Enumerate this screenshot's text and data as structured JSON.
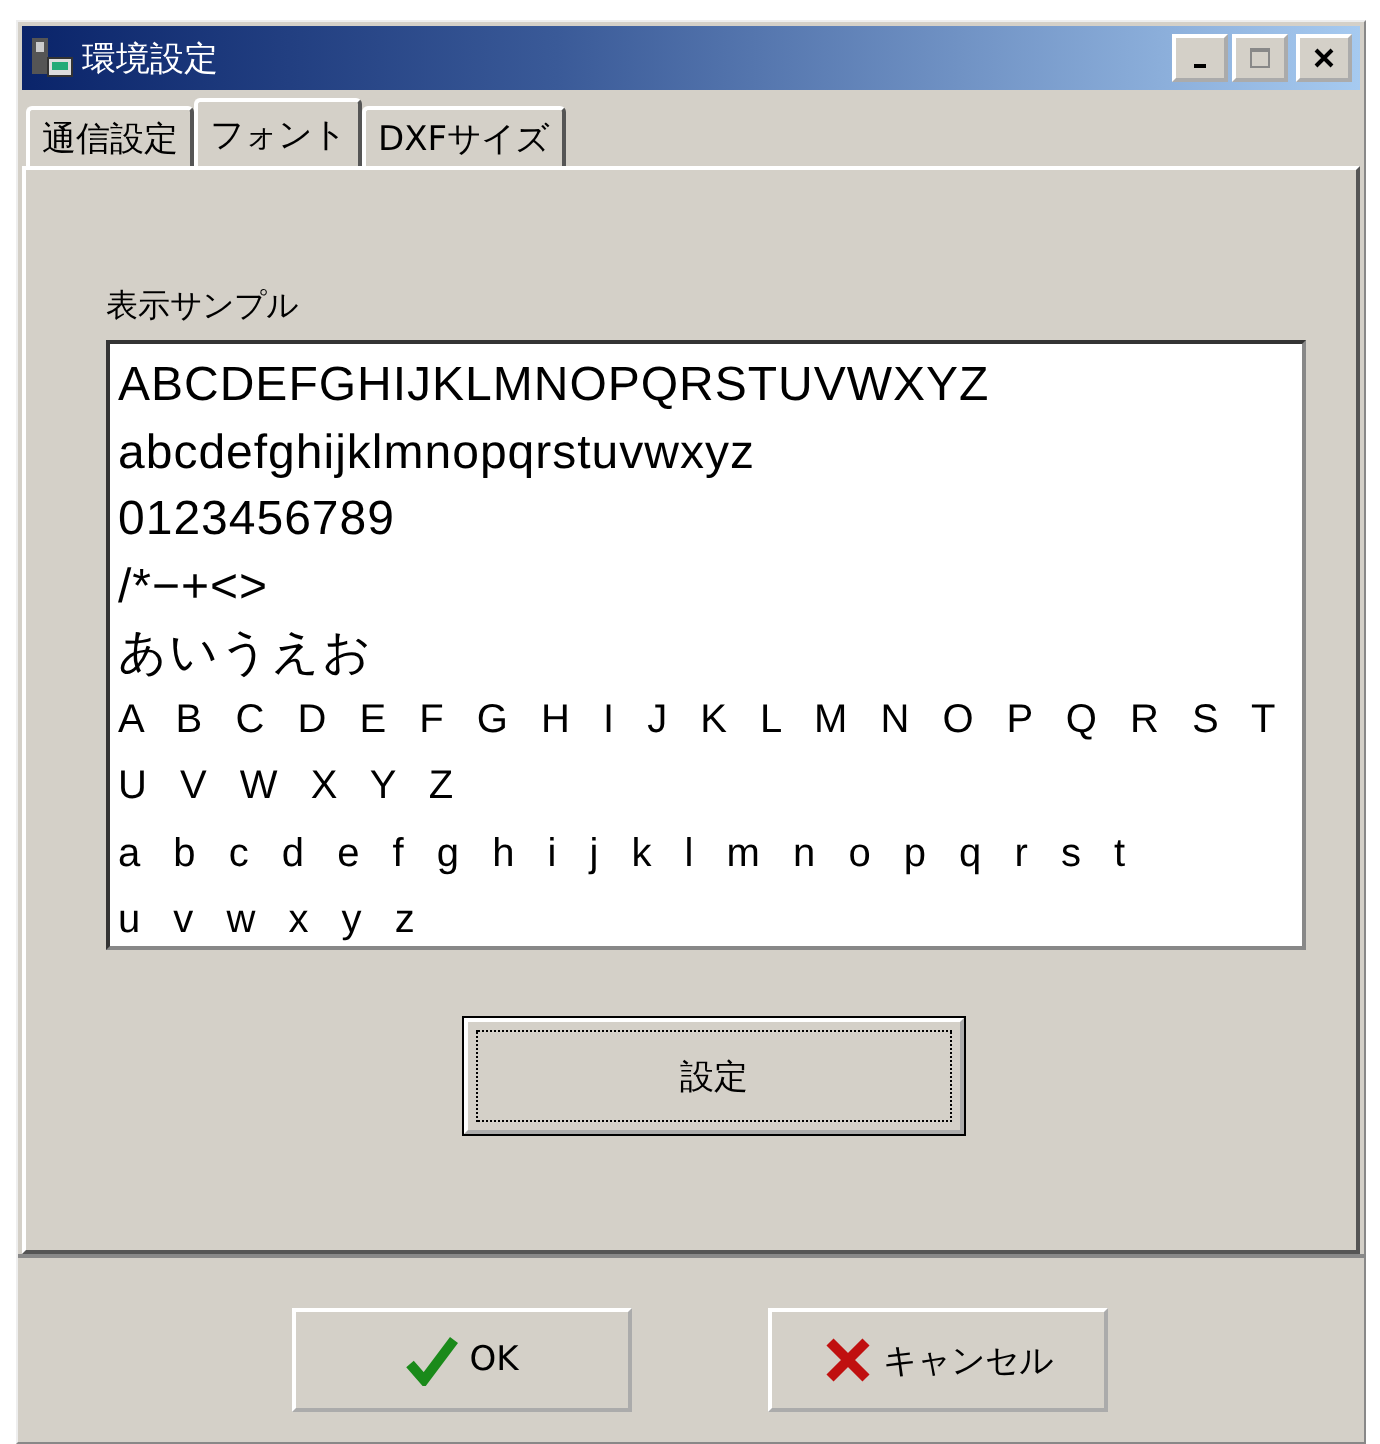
{
  "window": {
    "title": "環境設定"
  },
  "tabs": [
    {
      "label": "通信設定",
      "selected": false
    },
    {
      "label": "フォント",
      "selected": true
    },
    {
      "label": "DXFサイズ",
      "selected": false
    }
  ],
  "sample": {
    "label": "表示サンプル",
    "lines": [
      {
        "text": "ABCDEFGHIJKLMNOPQRSTUVWXYZ",
        "kind": "narrow"
      },
      {
        "text": "abcdefghijklmnopqrstuvwxyz",
        "kind": "narrow"
      },
      {
        "text": "0123456789",
        "kind": "narrow"
      },
      {
        "text": "/*−+<>",
        "kind": "narrow"
      },
      {
        "text": "あいうえお",
        "kind": "narrow"
      },
      {
        "text": "A B C D E F G H I J K L M N O P Q R S T",
        "kind": "wide"
      },
      {
        "text": "U V W X Y Z",
        "kind": "wide"
      },
      {
        "text": "a b c d e f g h i j k l m n o p q r s t",
        "kind": "wide"
      },
      {
        "text": "u v w x y z",
        "kind": "wide"
      }
    ]
  },
  "set_button": {
    "label": "設定"
  },
  "buttons": [
    {
      "label": "OK",
      "kind": "ok"
    },
    {
      "label": "キャンセル",
      "kind": "cancel"
    }
  ]
}
